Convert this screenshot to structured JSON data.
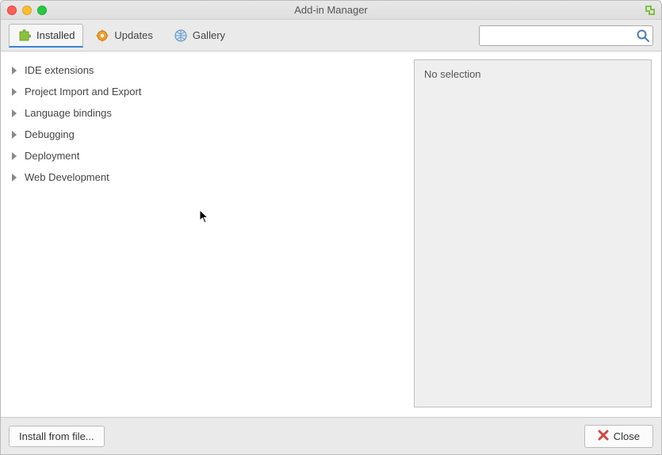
{
  "window": {
    "title": "Add-in Manager"
  },
  "tabs": {
    "installed": "Installed",
    "updates": "Updates",
    "gallery": "Gallery"
  },
  "search": {
    "value": "",
    "placeholder": ""
  },
  "categories": [
    {
      "label": "IDE extensions"
    },
    {
      "label": "Project Import and Export"
    },
    {
      "label": "Language bindings"
    },
    {
      "label": "Debugging"
    },
    {
      "label": "Deployment"
    },
    {
      "label": "Web Development"
    }
  ],
  "details": {
    "empty_text": "No selection"
  },
  "footer": {
    "install_from_file": "Install from file...",
    "close": "Close"
  }
}
